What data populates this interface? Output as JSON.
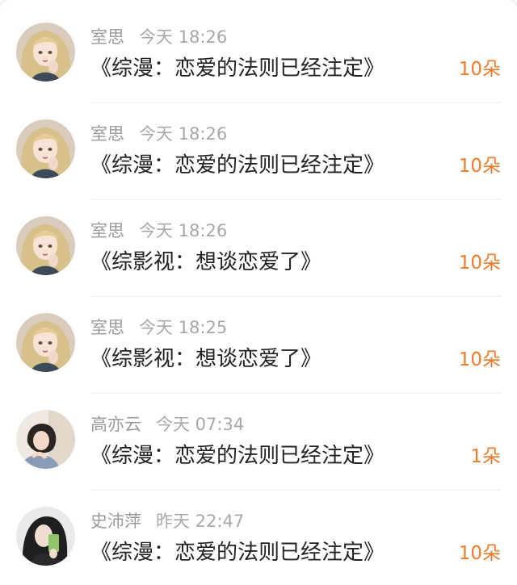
{
  "colors": {
    "accent": "#ee7b2a",
    "text": "#222222",
    "secondary": "#9a9a9a"
  },
  "gift_records": [
    {
      "user": "室思",
      "time": "今天 18:26",
      "title": "《综漫：恋爱的法则已经注定》",
      "amount": "10朵",
      "avatar": "avatar-anime-blonde-girl-icon"
    },
    {
      "user": "室思",
      "time": "今天 18:26",
      "title": "《综漫：恋爱的法则已经注定》",
      "amount": "10朵",
      "avatar": "avatar-anime-blonde-girl-icon"
    },
    {
      "user": "室思",
      "time": "今天 18:26",
      "title": "《综影视：想谈恋爱了》",
      "amount": "10朵",
      "avatar": "avatar-anime-blonde-girl-icon"
    },
    {
      "user": "室思",
      "time": "今天 18:25",
      "title": "《综影视：想谈恋爱了》",
      "amount": "10朵",
      "avatar": "avatar-anime-blonde-girl-icon"
    },
    {
      "user": "高亦云",
      "time": "今天 07:34",
      "title": "《综漫：恋爱的法则已经注定》",
      "amount": "1朵",
      "avatar": "avatar-girl-photo-icon"
    },
    {
      "user": "史沛萍",
      "time": "昨天 22:47",
      "title": "《综漫：恋爱的法则已经注定》",
      "amount": "10朵",
      "avatar": "avatar-girl-selfie-icon"
    }
  ]
}
